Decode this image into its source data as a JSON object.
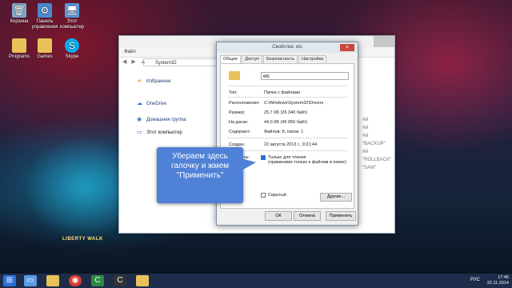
{
  "desktop": {
    "icons": [
      {
        "label": "Корзина",
        "icon": "recycle-bin-icon"
      },
      {
        "label": "Панель управления",
        "icon": "control-panel-icon"
      },
      {
        "label": "Этот компьютер",
        "icon": "computer-icon"
      },
      {
        "label": "Programs",
        "icon": "programs-icon"
      },
      {
        "label": "Games",
        "icon": "games-icon"
      },
      {
        "label": "Skype",
        "icon": "skype-icon"
      }
    ],
    "car_plate": "LIBERTY WALK"
  },
  "explorer": {
    "ribbon_file": "Файл",
    "address": "System32",
    "sidebar": [
      {
        "label": "Избранное",
        "icon": "star-icon"
      },
      {
        "label": "OneDrive",
        "icon": "cloud-icon"
      },
      {
        "label": "Домашняя группа",
        "icon": "homegroup-icon"
      },
      {
        "label": "Этот компьютер",
        "icon": "computer-icon"
      }
    ],
    "right_list": [
      "Ай",
      "Ай",
      "Ай",
      "\"BACKUP\"",
      "Ай",
      "\"ROLLBACK\"",
      "\"SAM\""
    ]
  },
  "dialog": {
    "title": "Свойства: etc",
    "tabs": [
      "Общие",
      "Доступ",
      "Безопасность",
      "Настройка"
    ],
    "active_tab": "Общие",
    "name": "etc",
    "props": [
      {
        "label": "Тип:",
        "value": "Папка с файлами"
      },
      {
        "label": "Расположение:",
        "value": "C:\\Windows\\System32\\Drivers"
      },
      {
        "label": "Размер:",
        "value": "25,7 КБ (26 340 байт)"
      },
      {
        "label": "На диске:",
        "value": "44,0 КБ (45 056 байт)"
      },
      {
        "label": "Содержит:",
        "value": "Файлов: 8, папок: 1"
      }
    ],
    "created_label": "Создан:",
    "created_value": "22 августа 2013 г., 9:21:44",
    "attributes_label": "Атрибуты:",
    "readonly_label": "Только для чтения",
    "readonly_note": "(применимо только к файлам в папке)",
    "hidden_label": "Скрытый",
    "other_button": "Другие...",
    "ok_button": "ОК",
    "cancel_button": "Отмена",
    "apply_button": "Применить"
  },
  "callout": {
    "line1": "Убераем здесь",
    "line2": "галочку и жмем",
    "line3": "\"Применить\""
  },
  "taskbar": {
    "lang": "РУС",
    "time": "17:46",
    "date": "22.11.2014"
  },
  "colors": {
    "callout": "#4f81d6",
    "taskbar": "#1d2c4a",
    "folder": "#e8c15a"
  }
}
